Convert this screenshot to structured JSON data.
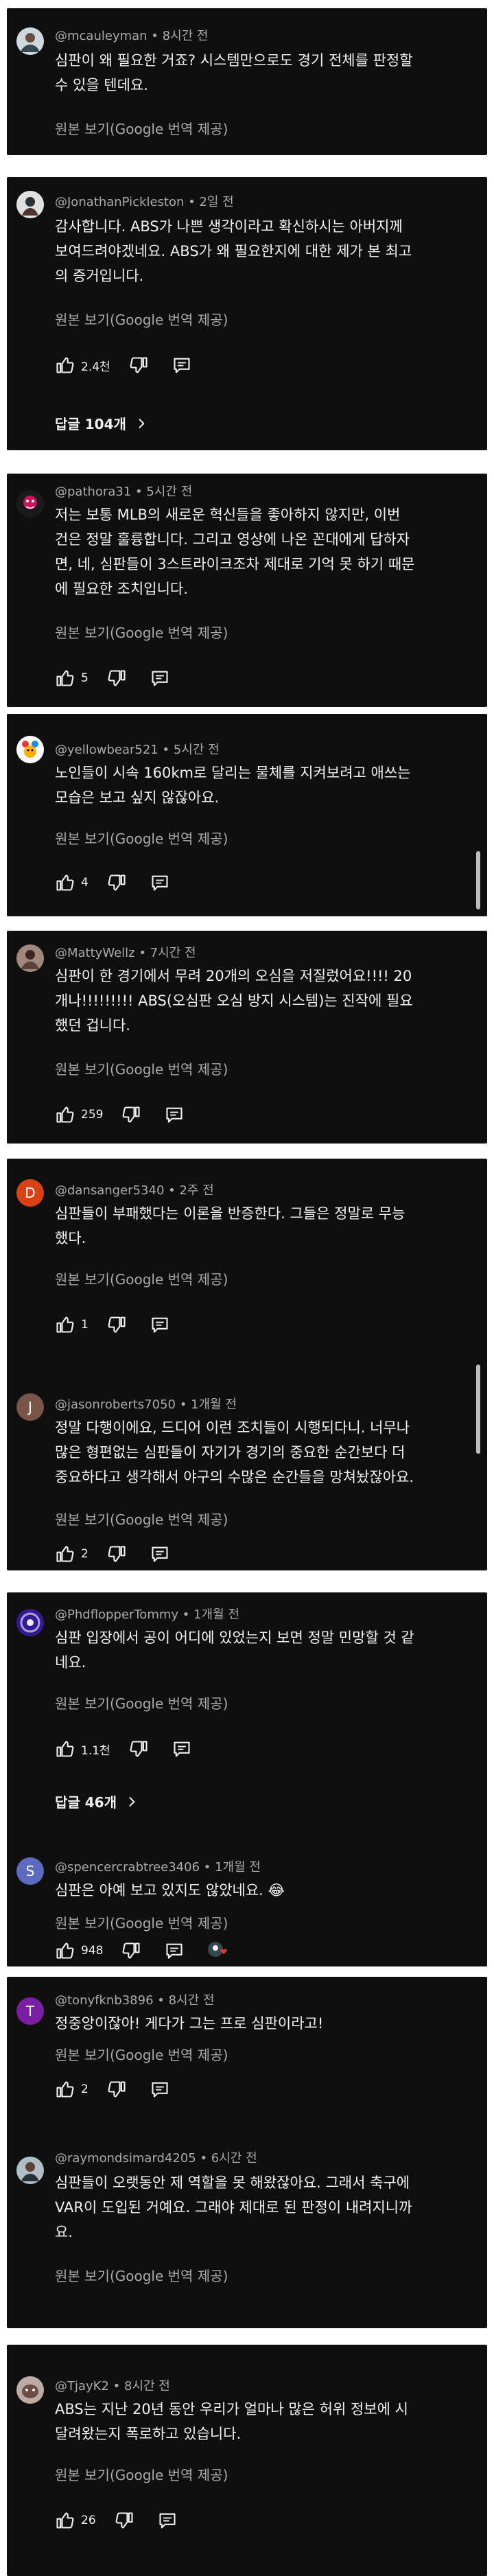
{
  "translate_label": "원본 보기(Google 번역 제공)",
  "colors": {
    "panel_bg": "#0f0f0f",
    "text": "#f1f1f1",
    "muted": "#aaaaaa",
    "avatar_d": "#d84315",
    "avatar_j": "#795548",
    "avatar_s": "#5c6bc0",
    "avatar_t": "#7b1fa2"
  },
  "panel1": {
    "c1": {
      "user": "@mcauleyman",
      "time": "8시간 전",
      "line1": "심판이 왜 필요한 거죠? 시스템만으로도 경기 전체를 판정할",
      "line2": "수 있을 텐데요."
    }
  },
  "panel2": {
    "c1": {
      "user": "@JonathanPickleston",
      "time": "2일 전",
      "line1": "감사합니다. ABS가 나쁜 생각이라고 확신하시는 아버지께",
      "line2": "보여드려야겠네요. ABS가 왜 필요한지에 대한 제가 본 최고",
      "line3": "의 증거입니다.",
      "likes": "2.4천",
      "replies": "답글 104개"
    }
  },
  "panel3": {
    "c1": {
      "user": "@pathora31",
      "time": "5시간 전",
      "line1": "저는 보통 MLB의 새로운 혁신들을 좋아하지 않지만, 이번",
      "line2": "건은 정말 훌륭합니다. 그리고 영상에 나온 꼰대에게 답하자",
      "line3": "면, 네, 심판들이 3스트라이크조차 제대로 기억 못 하기 때문",
      "line4": "에 필요한 조치입니다.",
      "likes": "5"
    }
  },
  "panel4": {
    "c1": {
      "user": "@yellowbear521",
      "time": "5시간 전",
      "line1": "노인들이 시속 160km로 달리는 물체를 지켜보려고 애쓰는",
      "line2": "모습은 보고 싶지 않잖아요.",
      "likes": "4"
    }
  },
  "panel5": {
    "c1": {
      "user": "@MattyWellz",
      "time": "7시간 전",
      "line1": "심판이 한 경기에서 무려 20개의 오심을 저질렀어요!!!! 20",
      "line2": "개나!!!!!!!!! ABS(오심판 오심 방지 시스템)는 진작에 필요",
      "line3": "했던 겁니다.",
      "likes": "259"
    }
  },
  "panel6": {
    "c1": {
      "avatar": "D",
      "user": "@dansanger5340",
      "time": "2주 전",
      "line1": "심판들이 부패했다는 이론을 반증한다. 그들은 정말로 무능",
      "line2": "했다.",
      "likes": "1"
    },
    "c2": {
      "avatar": "J",
      "user": "@jasonroberts7050",
      "time": "1개월 전",
      "line1": "정말 다행이에요, 드디어 이런 조치들이 시행되다니. 너무나",
      "line2": "많은 형편없는 심판들이 자기가 경기의 중요한 순간보다 더",
      "line3": "중요하다고 생각해서 야구의 수많은 순간들을 망쳐놨잖아요.",
      "likes": "2"
    }
  },
  "panel7": {
    "c1": {
      "user": "@PhdflopperTommy",
      "time": "1개월 전",
      "line1": "심판 입장에서 공이 어디에 있었는지 보면 정말 민망할 것 같",
      "line2": "네요.",
      "likes": "1.1천",
      "replies": "답글 46개"
    },
    "c2": {
      "avatar": "S",
      "user": "@spencercrabtree3406",
      "time": "1개월 전",
      "line1": "심판은 아예 보고 있지도 않았네요. 😂",
      "likes": "948"
    }
  },
  "panel8": {
    "c1": {
      "avatar": "T",
      "user": "@tonyfknb3896",
      "time": "8시간 전",
      "line1": "정중앙이잖아! 게다가 그는 프로 심판이라고!",
      "likes": "2"
    },
    "c2": {
      "user": "@raymondsimard4205",
      "time": "6시간 전",
      "line1": "심판들이 오랫동안 제 역할을 못 해왔잖아요. 그래서 축구에",
      "line2": "VAR이 도입된 거예요. 그래야 제대로 된 판정이 내려지니까",
      "line3": "요."
    }
  },
  "panel9": {
    "c1": {
      "user": "@TjayK2",
      "time": "8시간 전",
      "line1": "ABS는 지난 20년 동안 우리가 얼마나 많은 허위 정보에 시",
      "line2": "달려왔는지 폭로하고 있습니다.",
      "likes": "26"
    }
  }
}
